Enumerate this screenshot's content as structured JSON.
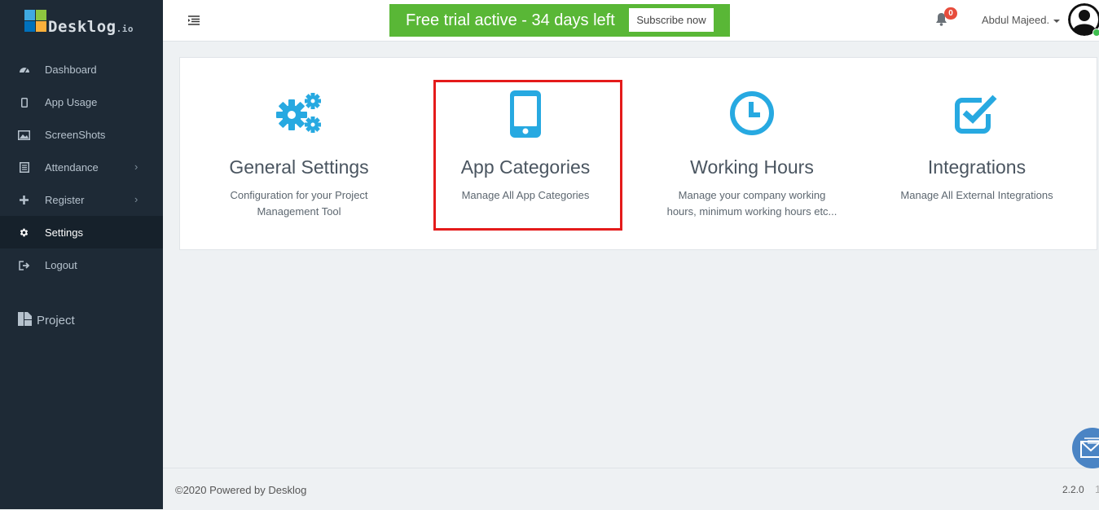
{
  "brand": {
    "name": "Desklog",
    "tld": ".io",
    "colors": [
      "#3fa9e0",
      "#8dc63f",
      "#0071bc",
      "#fbb03b"
    ]
  },
  "sidebar": {
    "items": [
      {
        "label": "Dashboard",
        "icon": "dashboard-icon",
        "has_submenu": false,
        "active": false
      },
      {
        "label": "App Usage",
        "icon": "mobile-icon",
        "has_submenu": false,
        "active": false
      },
      {
        "label": "ScreenShots",
        "icon": "image-icon",
        "has_submenu": false,
        "active": false
      },
      {
        "label": "Attendance",
        "icon": "list-icon",
        "has_submenu": true,
        "active": false
      },
      {
        "label": "Register",
        "icon": "plus-icon",
        "has_submenu": true,
        "active": false
      },
      {
        "label": "Settings",
        "icon": "gear-icon",
        "has_submenu": false,
        "active": true
      },
      {
        "label": "Logout",
        "icon": "sign-out-icon",
        "has_submenu": false,
        "active": false
      }
    ],
    "project_label": "Project"
  },
  "header": {
    "trial_text": "Free trial active - 34 days left",
    "subscribe_label": "Subscribe now",
    "notification_count": "0",
    "user_name": "Abdul Majeed."
  },
  "settings": {
    "tiles": [
      {
        "title": "General Settings",
        "description": "Configuration for your Project Management Tool",
        "icon": "gears-icon"
      },
      {
        "title": "App Categories",
        "description": "Manage All App Categories",
        "icon": "mobile-phone-icon",
        "highlighted": true
      },
      {
        "title": "Working Hours",
        "description": "Manage your company working hours, minimum working hours etc...",
        "icon": "clock-icon"
      },
      {
        "title": "Integrations",
        "description": "Manage All External Integrations",
        "icon": "check-square-icon"
      }
    ]
  },
  "footer": {
    "copyright": "©2020 Powered by Desklog",
    "version": "2.2.0",
    "ticker": "1"
  },
  "colors": {
    "sidebar_bg": "#1e2a36",
    "trial_green": "#59b736",
    "icon_blue": "#27a9e1",
    "highlight_red": "#e41b1b"
  }
}
